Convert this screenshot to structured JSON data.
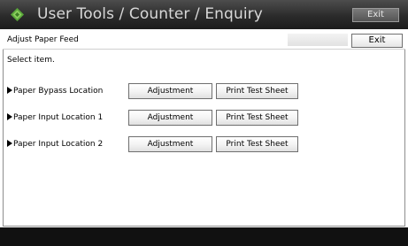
{
  "title_bar": {
    "title": "User Tools / Counter / Enquiry",
    "exit_label": "Exit",
    "logo_icon": "green-diamond-icon"
  },
  "header": {
    "page_title": "Adjust Paper Feed",
    "exit_label": "Exit"
  },
  "instruction": "Select item.",
  "items": [
    {
      "label": "Paper Bypass Location",
      "adjust_label": "Adjustment",
      "print_label": "Print Test Sheet"
    },
    {
      "label": "Paper Input Location 1",
      "adjust_label": "Adjustment",
      "print_label": "Print Test Sheet"
    },
    {
      "label": "Paper Input Location 2",
      "adjust_label": "Adjustment",
      "print_label": "Print Test Sheet"
    }
  ],
  "colors": {
    "title_bar": "#2b2b2b",
    "logo_green": "#5aa83a",
    "bottom_bar": "#111111"
  }
}
